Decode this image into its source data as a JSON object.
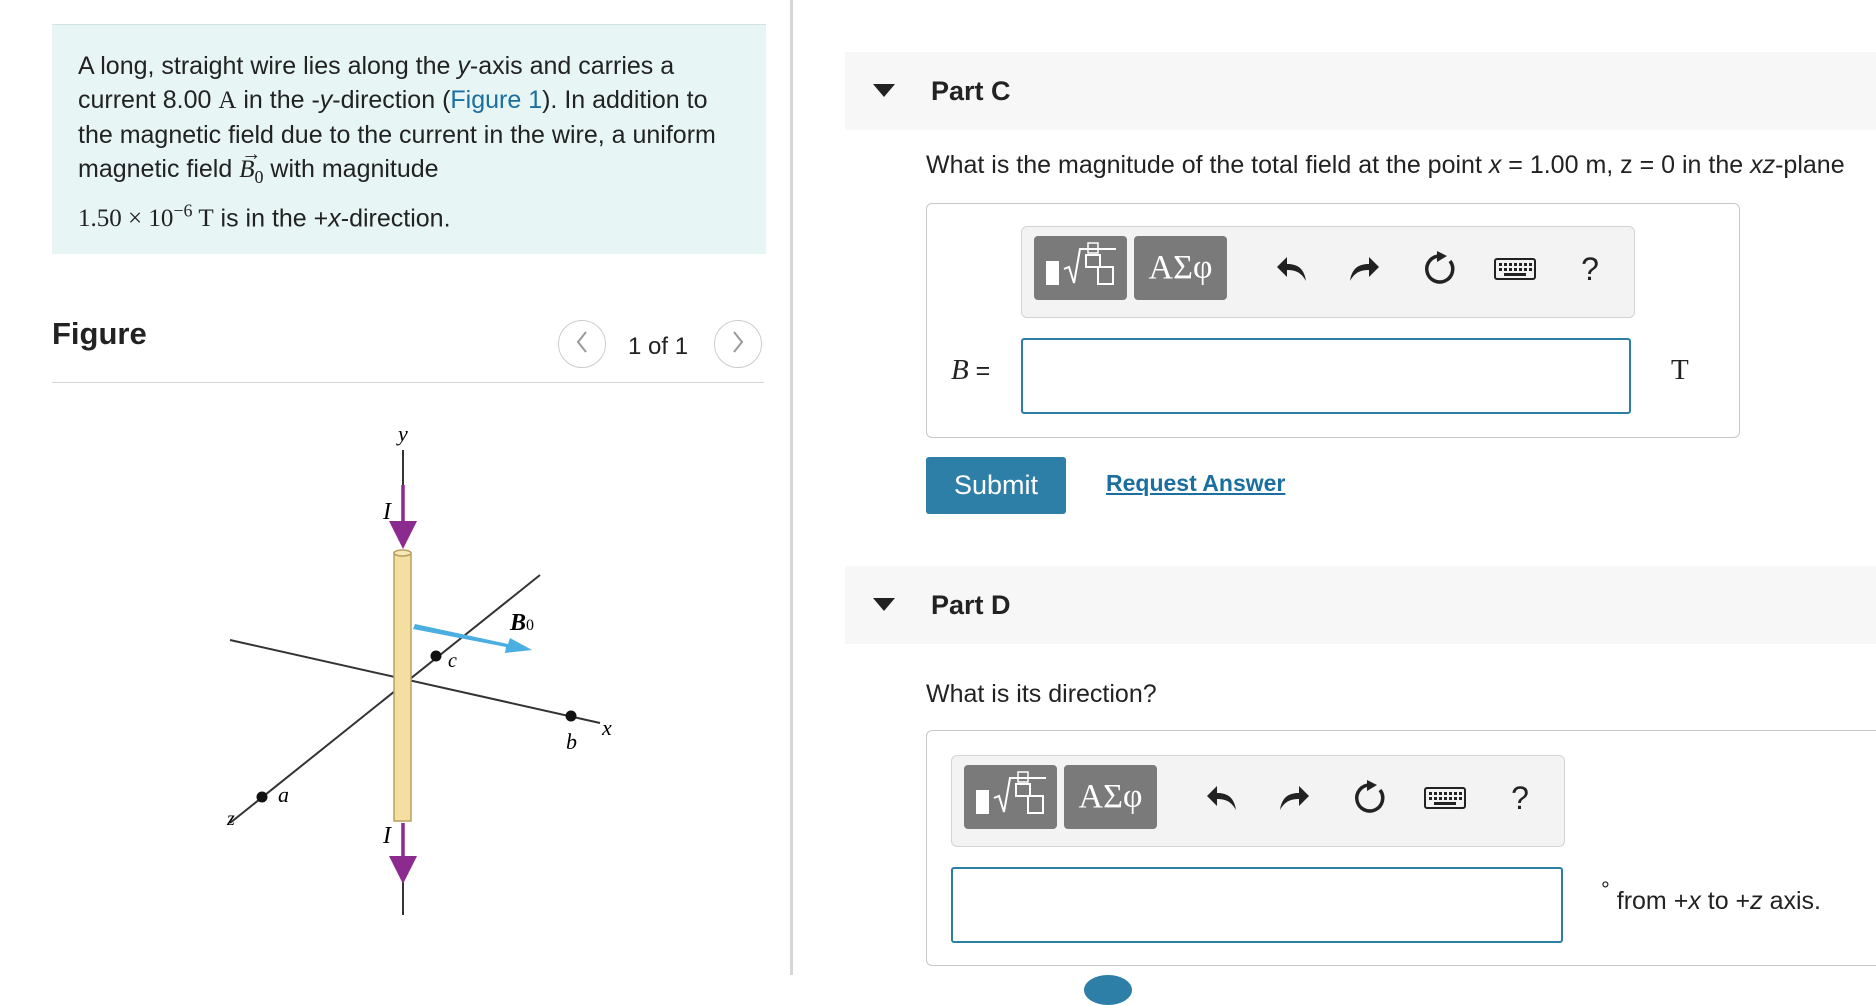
{
  "problem": {
    "s1": "A long, straight wire lies along the ",
    "var_y": "y",
    "s2": "-axis and carries a current 8.00 ",
    "unit_A": "A",
    "s3": " in the -",
    "s4": "-direction (",
    "figure_link": "Figure 1",
    "s5": "). In addition to the magnetic field due to the current in the wire, a uniform magnetic field ",
    "b0_letter": "B",
    "b0_sub": "0",
    "s6": " with magnitude",
    "mag_mantissa": "1.50 × 10",
    "mag_exp": "−6",
    "unit_T": " T",
    "s7": " is in the +",
    "var_x": "x",
    "s8": "-direction."
  },
  "figure": {
    "title": "Figure",
    "counter": "1 of 1",
    "labels": {
      "y": "y",
      "x": "x",
      "z": "z",
      "I_top": "I",
      "I_bottom": "I",
      "a": "a",
      "b": "b",
      "c": "c",
      "B0": "B",
      "B0_sub": "0"
    },
    "colors": {
      "wire": "#f3dfa0",
      "current_arrow": "#8b2b8f",
      "field_arrow": "#4aaee0"
    }
  },
  "partC": {
    "title": "Part C",
    "q1": "What is the magnitude of the total field at the point ",
    "q_x": "x",
    "q2": " = 1.00 m, z = 0 in the ",
    "q_xz": "xz",
    "q3": "-plane",
    "var_label": "B",
    "eq": " =",
    "unit": "T",
    "toolbar_greek": "ΑΣφ",
    "help": "?"
  },
  "submit_label": "Submit",
  "request_answer": "Request Answer",
  "partD": {
    "title": "Part D",
    "question": "What is its direction?",
    "degree": "°",
    "u1": " from +",
    "u_x": "x",
    "u2": " to +",
    "u_z": "z",
    "u3": " axis.",
    "toolbar_greek": "ΑΣφ",
    "help": "?"
  }
}
